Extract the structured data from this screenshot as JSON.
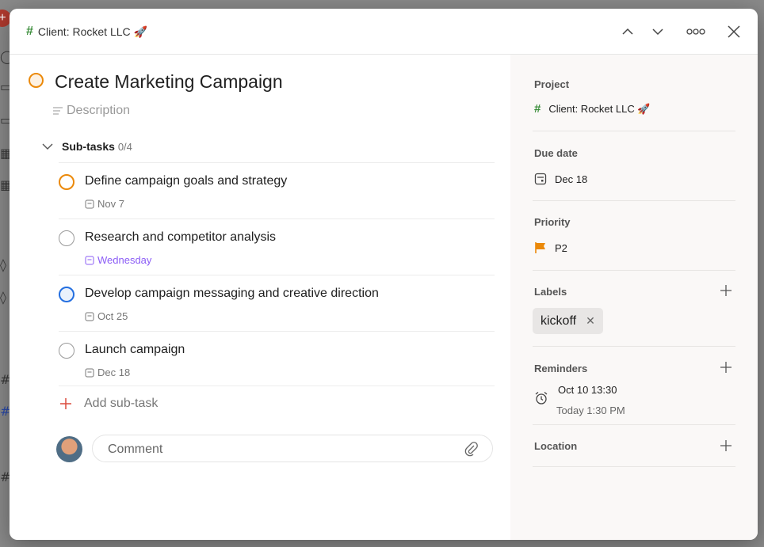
{
  "header": {
    "project": "Client: Rocket LLC 🚀"
  },
  "task": {
    "title": "Create Marketing Campaign",
    "description_placeholder": "Description"
  },
  "subtasks": {
    "label": "Sub-tasks",
    "count": "0/4",
    "items": [
      {
        "title": "Define campaign goals and strategy",
        "date": "Nov 7",
        "check_color": "#eb8909",
        "date_color": "#777777"
      },
      {
        "title": "Research and competitor analysis",
        "date": "Wednesday",
        "check_color": "#999999",
        "date_color": "#8b5cf6"
      },
      {
        "title": "Develop campaign messaging and creative direction",
        "date": "Oct 25",
        "check_color": "#246fe0",
        "date_color": "#777777"
      },
      {
        "title": "Launch campaign",
        "date": "Dec 18",
        "check_color": "#999999",
        "date_color": "#777777"
      }
    ],
    "add_label": "Add sub-task"
  },
  "comment": {
    "placeholder": "Comment"
  },
  "sidebar": {
    "project_label": "Project",
    "project_value": "Client: Rocket LLC 🚀",
    "due_label": "Due date",
    "due_value": "Dec 18",
    "priority_label": "Priority",
    "priority_value": "P2",
    "priority_color": "#eb8909",
    "labels_label": "Labels",
    "label_chip": "kickoff",
    "reminders_label": "Reminders",
    "reminder_time": "Oct 10 13:30",
    "reminder_relative": "Today 1:30 PM",
    "location_label": "Location"
  },
  "colors": {
    "project_hash": "#3a8d3a",
    "add_plus": "#dc4c3e"
  }
}
